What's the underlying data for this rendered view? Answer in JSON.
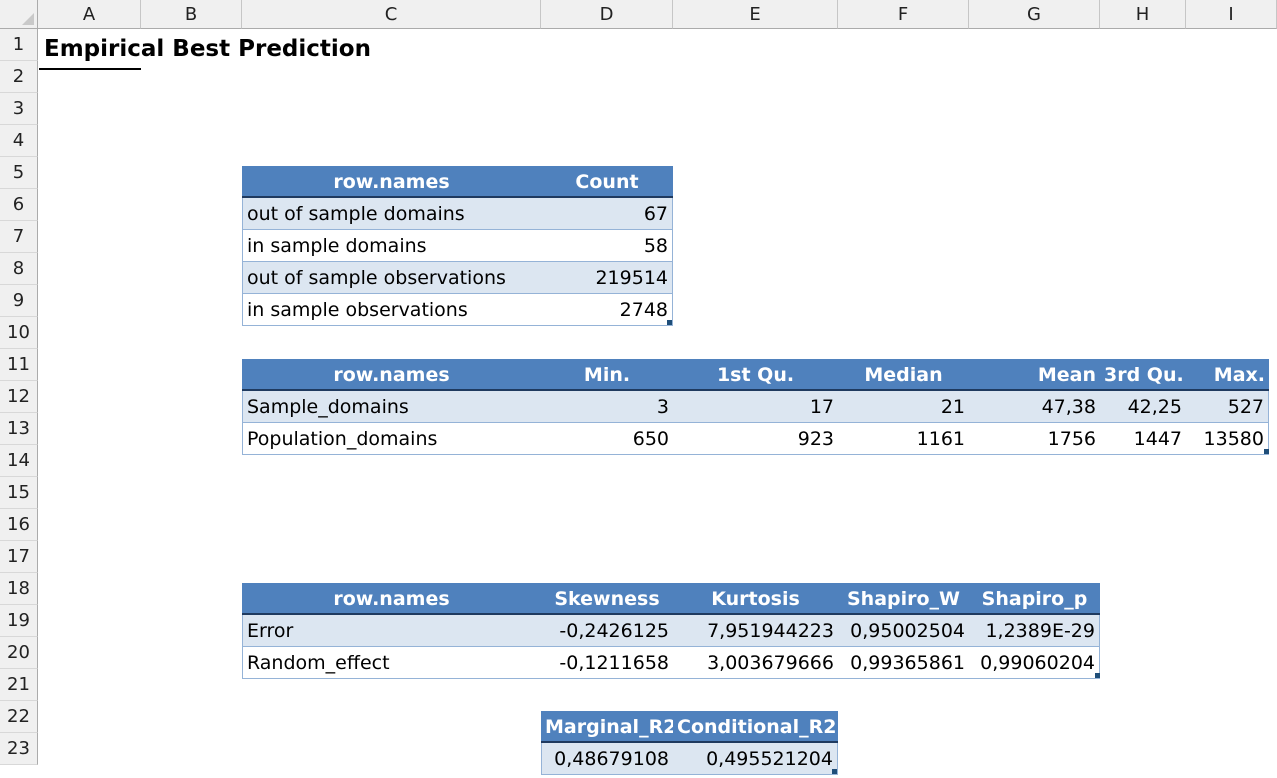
{
  "sheet": {
    "columns": [
      "A",
      "B",
      "C",
      "D",
      "E",
      "F",
      "G",
      "H",
      "I"
    ],
    "rows": [
      "1",
      "2",
      "3",
      "4",
      "5",
      "6",
      "7",
      "8",
      "9",
      "10",
      "11",
      "12",
      "13",
      "14",
      "15",
      "16",
      "17",
      "18",
      "19",
      "20",
      "21",
      "22",
      "23"
    ],
    "title": "Empirical Best Prediction"
  },
  "table_counts": {
    "headers": [
      "row.names",
      "Count"
    ],
    "rows": [
      [
        "out of sample domains",
        "67"
      ],
      [
        "in sample domains",
        "58"
      ],
      [
        "out of sample observations",
        "219514"
      ],
      [
        "in sample observations",
        "2748"
      ]
    ]
  },
  "table_summary": {
    "headers": [
      "row.names",
      "Min.",
      "1st Qu.",
      "Median",
      "Mean",
      "3rd Qu.",
      "Max."
    ],
    "rows": [
      [
        "Sample_domains",
        "3",
        "17",
        "21",
        "47,38",
        "42,25",
        "527"
      ],
      [
        "Population_domains",
        "650",
        "923",
        "1161",
        "1756",
        "1447",
        "13580"
      ]
    ]
  },
  "table_normality": {
    "headers": [
      "row.names",
      "Skewness",
      "Kurtosis",
      "Shapiro_W",
      "Shapiro_p"
    ],
    "rows": [
      [
        "Error",
        "-0,2426125",
        "7,951944223",
        "0,95002504",
        "1,2389E-29"
      ],
      [
        "Random_effect",
        "-0,1211658",
        "3,003679666",
        "0,99365861",
        "0,99060204"
      ]
    ]
  },
  "table_r2": {
    "headers": [
      "Marginal_R2",
      "Conditional_R2"
    ],
    "rows": [
      [
        "0,48679108",
        "0,495521204"
      ]
    ]
  },
  "colors": {
    "header_fill": "#4f81bd",
    "band_fill": "#dce6f1",
    "border": "#95b3d7"
  }
}
